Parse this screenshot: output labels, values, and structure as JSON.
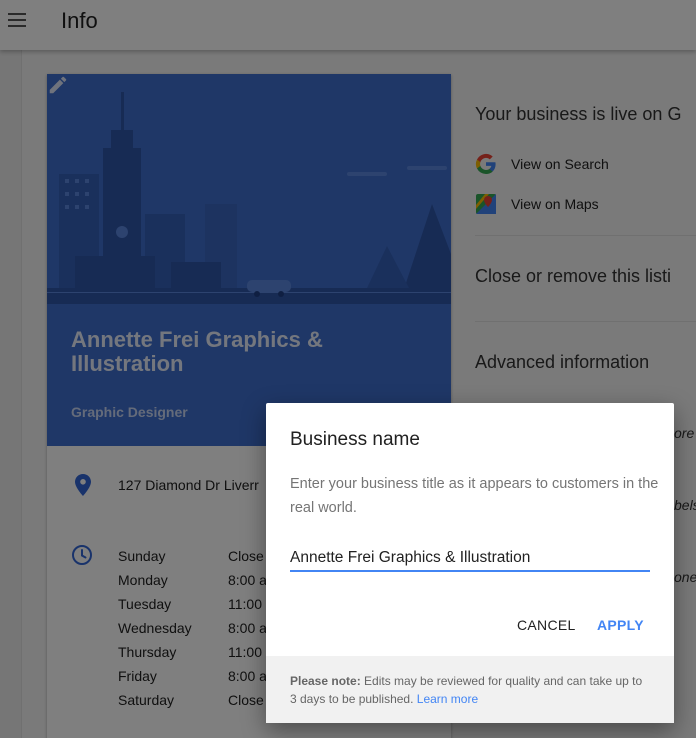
{
  "header": {
    "title": "Info"
  },
  "card": {
    "name": "Annette Frei Graphics & Illustration",
    "category": "Graphic Designer",
    "address": "127 Diamond Dr Liverr",
    "hours": [
      {
        "day": "Sunday",
        "time": "Close"
      },
      {
        "day": "Monday",
        "time": "8:00 a"
      },
      {
        "day": "Tuesday",
        "time": "11:00"
      },
      {
        "day": "Wednesday",
        "time": "8:00 a"
      },
      {
        "day": "Thursday",
        "time": "11:00"
      },
      {
        "day": "Friday",
        "time": "8:00 a"
      },
      {
        "day": "Saturday",
        "time": "Close"
      }
    ]
  },
  "right_panel": {
    "live_heading": "Your business is live on G",
    "view_search": "View on Search",
    "view_maps": "View on Maps",
    "close_heading": "Close or remove this listi",
    "advanced_heading": "Advanced information",
    "peek": [
      "ore",
      "bels",
      "one"
    ]
  },
  "dialog": {
    "title": "Business name",
    "description": "Enter your business title as it appears to customers in the real world.",
    "input_value": "Annette Frei Graphics & Illustration",
    "cancel_label": "CANCEL",
    "apply_label": "APPLY",
    "note_label": "Please note:",
    "note_text": " Edits may be reviewed for quality and can take up to 3 days to be published. ",
    "learn_more": "Learn more"
  },
  "icons": {
    "menu": "hamburger-icon",
    "edit": "pencil-icon",
    "location": "location-pin-icon",
    "hours": "clock-icon",
    "search": "google-g-icon",
    "maps": "google-maps-icon"
  },
  "colors": {
    "hero_blue": "#3f6fcf",
    "accent": "#4285f4"
  }
}
